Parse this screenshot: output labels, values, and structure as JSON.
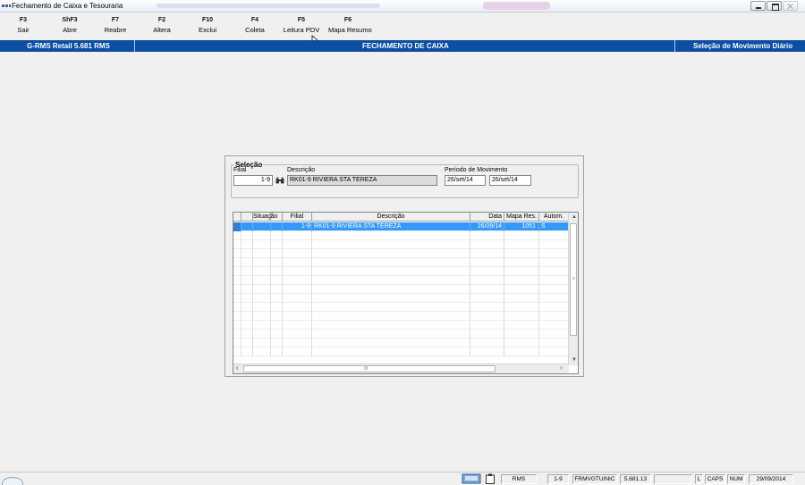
{
  "window": {
    "title": "Fechamento de Caixa e Tesouraria"
  },
  "toolbar": {
    "keys": [
      {
        "key": "F3",
        "label": "Sair"
      },
      {
        "key": "ShF3",
        "label": "Abre"
      },
      {
        "key": "F7",
        "label": "Reabre"
      },
      {
        "key": "F2",
        "label": "Altera"
      },
      {
        "key": "F10",
        "label": "Exclui"
      },
      {
        "key": "F4",
        "label": "Coleta"
      },
      {
        "key": "F5",
        "label": "Leitura PDV"
      },
      {
        "key": "F6",
        "label": "Mapa Resumo"
      }
    ]
  },
  "header": {
    "system": "G-RMS Retail 5.681 RMS",
    "screen": "FECHAMENTO DE CAIXA",
    "context": "Seleção de Movimento Diário",
    "color": "#0b4ea2"
  },
  "selection": {
    "legend": "Seleção",
    "filial_label": "Filial",
    "filial_value": "1-9",
    "descricao_label": "Descrição",
    "descricao_value": "RK01-9 RIVIERA STA TEREZA",
    "periodo_label": "Período de Movimento",
    "periodo_inicio": "26/set/14",
    "periodo_fim": "26/set/14"
  },
  "grid": {
    "columns": [
      "Situação",
      "Filial",
      "Descrição",
      "Data",
      "Mapa Res.",
      "Autom."
    ],
    "rows": [
      {
        "situacao": "",
        "filial": "1-9",
        "descricao": "RK01-9 RIVIERA STA TEREZA",
        "data": "26/09/14",
        "mapa": "1051",
        "autom": "S"
      }
    ],
    "scroll_left": "‹",
    "scroll_right": "›",
    "scroll_grip": "III",
    "selection_color": "#3399ff"
  },
  "status": {
    "module": "RMS",
    "filial": "1-9",
    "program": "FRMVGTUINIC",
    "version": "5.681.13",
    "l": "L",
    "caps": "CAPS",
    "num": "NUM",
    "date": "29/09/2014"
  }
}
